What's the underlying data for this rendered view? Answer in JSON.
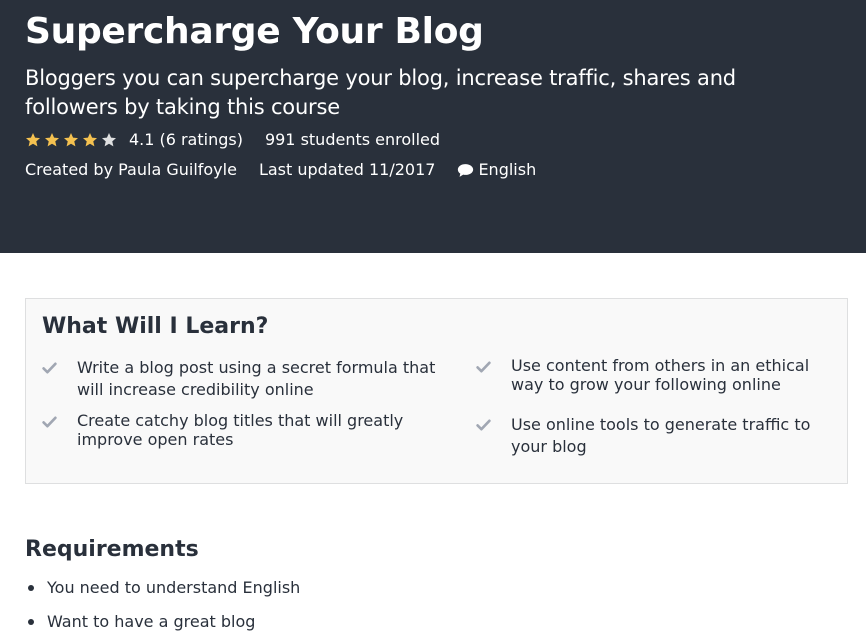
{
  "course": {
    "title": "Supercharge Your Blog",
    "subtitle": "Bloggers you can supercharge your blog, increase traffic, shares and followers by taking this course",
    "rating": {
      "stars_filled": 4,
      "stars_total": 5,
      "value": "4.1",
      "count_text": "(6 ratings)"
    },
    "enrolled_text": "991 students enrolled",
    "created_by": "Created by Paula Guilfoyle",
    "last_updated": "Last updated 11/2017",
    "language": "English"
  },
  "learn": {
    "title": "What Will I Learn?",
    "items": [
      "Write a blog post using a secret formula that will increase credibility online",
      "Create catchy blog titles that will greatly improve open rates",
      "Use content from others in an ethical way to grow your following online",
      "Use online tools to generate traffic to your blog"
    ]
  },
  "requirements": {
    "title": "Requirements",
    "items": [
      "You need to understand English",
      "Want to have a great blog"
    ]
  },
  "colors": {
    "hero_bg": "#29303b",
    "star_filled": "#f4c150",
    "star_empty": "#dedfe0",
    "check": "#a1a7b3"
  },
  "icons": {
    "star": "star-icon",
    "chat": "chat-bubble-icon",
    "check": "check-icon"
  }
}
